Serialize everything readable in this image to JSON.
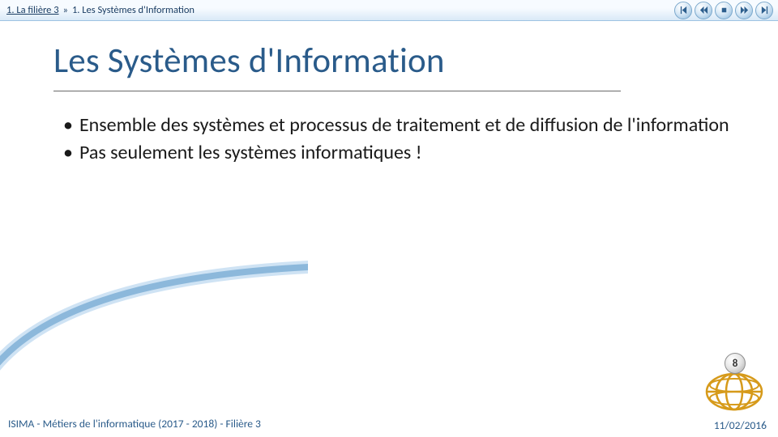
{
  "breadcrumb": {
    "parent": "1. La filière 3",
    "separator": "»",
    "current": "1. Les Systèmes d'Information"
  },
  "controls": {
    "first": "first-slide",
    "prev": "previous-slide",
    "stop": "stop",
    "next": "next-slide",
    "last": "last-slide"
  },
  "title": "Les Systèmes d'Information",
  "bullets": [
    "Ensemble des systèmes et processus de traitement et de diffusion de l'information",
    "Pas seulement les systèmes informatiques !"
  ],
  "footer": {
    "left": "ISIMA - Métiers de l'informatique (2017 - 2018) - Filière 3",
    "date": "11/02/2016"
  },
  "slide_number": "8",
  "colors": {
    "accent": "#2a5b8a",
    "gold": "#d69a1a"
  }
}
